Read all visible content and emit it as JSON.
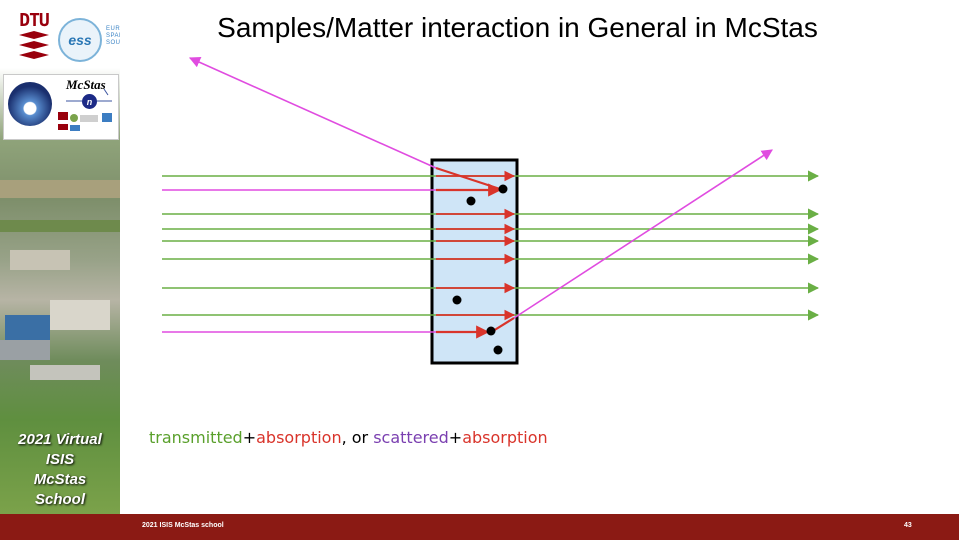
{
  "slide": {
    "title": "Samples/Matter interaction in General in McStas",
    "footer_text": "2021 ISIS McStas school",
    "page_number": "43"
  },
  "sidebar": {
    "dtu_logo": "DTU",
    "ess_logo_mark": "ess",
    "ess_logo_text": "European Spallation Source",
    "mcstas_logo": "McStas",
    "neutron_symbol": "n",
    "school_label": [
      "2021 Virtual",
      "ISIS",
      "McStas",
      "School"
    ]
  },
  "legend": [
    {
      "text": "transmitted",
      "color": "#5aa02c"
    },
    {
      "text": "+",
      "color": "#000000"
    },
    {
      "text": "absorption",
      "color": "#d9342b"
    },
    {
      "text": ", or ",
      "color": "#000000"
    },
    {
      "text": "scattered",
      "color": "#7a3fb0"
    },
    {
      "text": "+",
      "color": "#000000"
    },
    {
      "text": "absorption",
      "color": "#d9342b"
    }
  ],
  "colors": {
    "transmitted": "#6aaf45",
    "absorbed": "#d9342b",
    "scattered": "#e04ce0",
    "sample_fill": "#cfe5f7",
    "footer": "#8b1a14"
  }
}
